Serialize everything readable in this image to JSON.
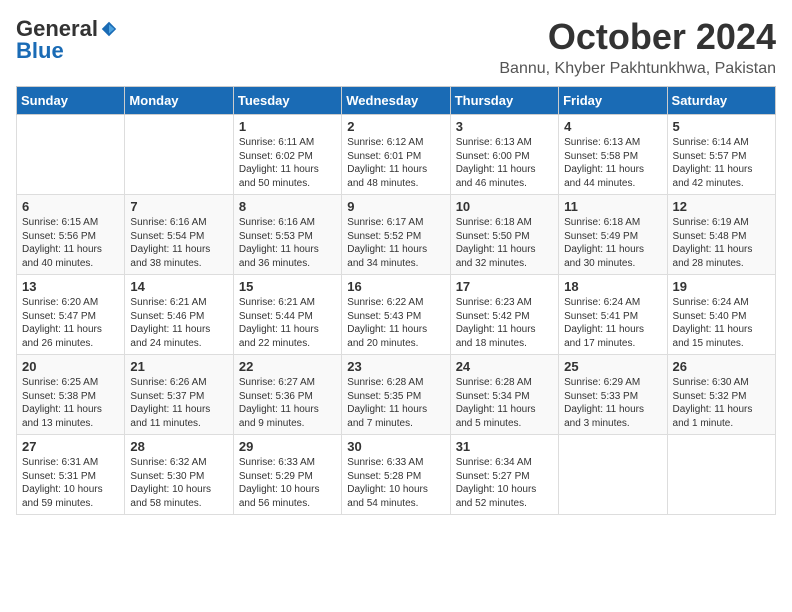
{
  "logo": {
    "general": "General",
    "blue": "Blue"
  },
  "title": "October 2024",
  "location": "Bannu, Khyber Pakhtunkhwa, Pakistan",
  "days_of_week": [
    "Sunday",
    "Monday",
    "Tuesday",
    "Wednesday",
    "Thursday",
    "Friday",
    "Saturday"
  ],
  "weeks": [
    [
      {
        "day": "",
        "sunrise": "",
        "sunset": "",
        "daylight": ""
      },
      {
        "day": "",
        "sunrise": "",
        "sunset": "",
        "daylight": ""
      },
      {
        "day": "1",
        "sunrise": "Sunrise: 6:11 AM",
        "sunset": "Sunset: 6:02 PM",
        "daylight": "Daylight: 11 hours and 50 minutes."
      },
      {
        "day": "2",
        "sunrise": "Sunrise: 6:12 AM",
        "sunset": "Sunset: 6:01 PM",
        "daylight": "Daylight: 11 hours and 48 minutes."
      },
      {
        "day": "3",
        "sunrise": "Sunrise: 6:13 AM",
        "sunset": "Sunset: 6:00 PM",
        "daylight": "Daylight: 11 hours and 46 minutes."
      },
      {
        "day": "4",
        "sunrise": "Sunrise: 6:13 AM",
        "sunset": "Sunset: 5:58 PM",
        "daylight": "Daylight: 11 hours and 44 minutes."
      },
      {
        "day": "5",
        "sunrise": "Sunrise: 6:14 AM",
        "sunset": "Sunset: 5:57 PM",
        "daylight": "Daylight: 11 hours and 42 minutes."
      }
    ],
    [
      {
        "day": "6",
        "sunrise": "Sunrise: 6:15 AM",
        "sunset": "Sunset: 5:56 PM",
        "daylight": "Daylight: 11 hours and 40 minutes."
      },
      {
        "day": "7",
        "sunrise": "Sunrise: 6:16 AM",
        "sunset": "Sunset: 5:54 PM",
        "daylight": "Daylight: 11 hours and 38 minutes."
      },
      {
        "day": "8",
        "sunrise": "Sunrise: 6:16 AM",
        "sunset": "Sunset: 5:53 PM",
        "daylight": "Daylight: 11 hours and 36 minutes."
      },
      {
        "day": "9",
        "sunrise": "Sunrise: 6:17 AM",
        "sunset": "Sunset: 5:52 PM",
        "daylight": "Daylight: 11 hours and 34 minutes."
      },
      {
        "day": "10",
        "sunrise": "Sunrise: 6:18 AM",
        "sunset": "Sunset: 5:50 PM",
        "daylight": "Daylight: 11 hours and 32 minutes."
      },
      {
        "day": "11",
        "sunrise": "Sunrise: 6:18 AM",
        "sunset": "Sunset: 5:49 PM",
        "daylight": "Daylight: 11 hours and 30 minutes."
      },
      {
        "day": "12",
        "sunrise": "Sunrise: 6:19 AM",
        "sunset": "Sunset: 5:48 PM",
        "daylight": "Daylight: 11 hours and 28 minutes."
      }
    ],
    [
      {
        "day": "13",
        "sunrise": "Sunrise: 6:20 AM",
        "sunset": "Sunset: 5:47 PM",
        "daylight": "Daylight: 11 hours and 26 minutes."
      },
      {
        "day": "14",
        "sunrise": "Sunrise: 6:21 AM",
        "sunset": "Sunset: 5:46 PM",
        "daylight": "Daylight: 11 hours and 24 minutes."
      },
      {
        "day": "15",
        "sunrise": "Sunrise: 6:21 AM",
        "sunset": "Sunset: 5:44 PM",
        "daylight": "Daylight: 11 hours and 22 minutes."
      },
      {
        "day": "16",
        "sunrise": "Sunrise: 6:22 AM",
        "sunset": "Sunset: 5:43 PM",
        "daylight": "Daylight: 11 hours and 20 minutes."
      },
      {
        "day": "17",
        "sunrise": "Sunrise: 6:23 AM",
        "sunset": "Sunset: 5:42 PM",
        "daylight": "Daylight: 11 hours and 18 minutes."
      },
      {
        "day": "18",
        "sunrise": "Sunrise: 6:24 AM",
        "sunset": "Sunset: 5:41 PM",
        "daylight": "Daylight: 11 hours and 17 minutes."
      },
      {
        "day": "19",
        "sunrise": "Sunrise: 6:24 AM",
        "sunset": "Sunset: 5:40 PM",
        "daylight": "Daylight: 11 hours and 15 minutes."
      }
    ],
    [
      {
        "day": "20",
        "sunrise": "Sunrise: 6:25 AM",
        "sunset": "Sunset: 5:38 PM",
        "daylight": "Daylight: 11 hours and 13 minutes."
      },
      {
        "day": "21",
        "sunrise": "Sunrise: 6:26 AM",
        "sunset": "Sunset: 5:37 PM",
        "daylight": "Daylight: 11 hours and 11 minutes."
      },
      {
        "day": "22",
        "sunrise": "Sunrise: 6:27 AM",
        "sunset": "Sunset: 5:36 PM",
        "daylight": "Daylight: 11 hours and 9 minutes."
      },
      {
        "day": "23",
        "sunrise": "Sunrise: 6:28 AM",
        "sunset": "Sunset: 5:35 PM",
        "daylight": "Daylight: 11 hours and 7 minutes."
      },
      {
        "day": "24",
        "sunrise": "Sunrise: 6:28 AM",
        "sunset": "Sunset: 5:34 PM",
        "daylight": "Daylight: 11 hours and 5 minutes."
      },
      {
        "day": "25",
        "sunrise": "Sunrise: 6:29 AM",
        "sunset": "Sunset: 5:33 PM",
        "daylight": "Daylight: 11 hours and 3 minutes."
      },
      {
        "day": "26",
        "sunrise": "Sunrise: 6:30 AM",
        "sunset": "Sunset: 5:32 PM",
        "daylight": "Daylight: 11 hours and 1 minute."
      }
    ],
    [
      {
        "day": "27",
        "sunrise": "Sunrise: 6:31 AM",
        "sunset": "Sunset: 5:31 PM",
        "daylight": "Daylight: 10 hours and 59 minutes."
      },
      {
        "day": "28",
        "sunrise": "Sunrise: 6:32 AM",
        "sunset": "Sunset: 5:30 PM",
        "daylight": "Daylight: 10 hours and 58 minutes."
      },
      {
        "day": "29",
        "sunrise": "Sunrise: 6:33 AM",
        "sunset": "Sunset: 5:29 PM",
        "daylight": "Daylight: 10 hours and 56 minutes."
      },
      {
        "day": "30",
        "sunrise": "Sunrise: 6:33 AM",
        "sunset": "Sunset: 5:28 PM",
        "daylight": "Daylight: 10 hours and 54 minutes."
      },
      {
        "day": "31",
        "sunrise": "Sunrise: 6:34 AM",
        "sunset": "Sunset: 5:27 PM",
        "daylight": "Daylight: 10 hours and 52 minutes."
      },
      {
        "day": "",
        "sunrise": "",
        "sunset": "",
        "daylight": ""
      },
      {
        "day": "",
        "sunrise": "",
        "sunset": "",
        "daylight": ""
      }
    ]
  ]
}
